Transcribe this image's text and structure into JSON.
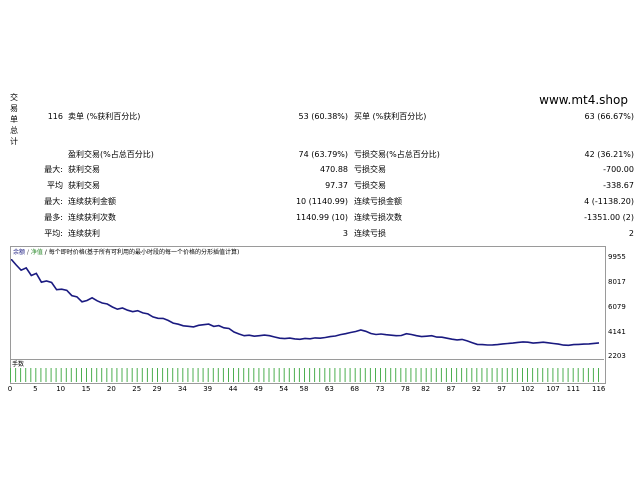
{
  "report": {
    "vertical_title": [
      "交",
      "易",
      "单",
      "总",
      "计"
    ],
    "count": "116",
    "site": "www.mt4.shop"
  },
  "stats": [
    {
      "l1": "卖单 (%获利百分比)",
      "v1": "53 (60.38%)",
      "l2": "买单 (%获利百分比)",
      "v2": "63 (66.67%)"
    },
    {
      "l1": "盈利交易(%占总百分比)",
      "v1": "74 (63.79%)",
      "l2": "亏损交易(%占总百分比)",
      "v2": "42 (36.21%)"
    },
    {
      "pre": "最大:",
      "l1": "获利交易",
      "v1": "470.88",
      "l2": "亏损交易",
      "v2": "-700.00"
    },
    {
      "pre": "平均",
      "l1": "获利交易",
      "v1": "97.37",
      "l2": "亏损交易",
      "v2": "-338.67"
    },
    {
      "pre": "最大:",
      "l1": "连续获利金额",
      "v1": "10 (1140.99)",
      "l2": "连续亏损金额",
      "v2": "4 (-1138.20)"
    },
    {
      "pre": "最多:",
      "l1": "连续获利次数",
      "v1": "1140.99 (10)",
      "l2": "连续亏损次数",
      "v2": "-1351.00 (2)"
    },
    {
      "pre": "平均:",
      "l1": "连续获利",
      "v1": "3",
      "l2": "连续亏损",
      "v2": "2"
    }
  ],
  "chart_data": {
    "type": "line",
    "title": "",
    "header": {
      "balance": "余额",
      "sep": " / ",
      "equity": "净值",
      "desc": " / 每个即时价格(基于所有可利用的最小时段的每一个价格的分形插值计算)"
    },
    "ylim": [
      2203,
      9955
    ],
    "yticks": [
      "9955",
      "8017",
      "6079",
      "4141",
      "2203"
    ],
    "xticks": [
      "0",
      "5",
      "10",
      "15",
      "20",
      "25",
      "29",
      "34",
      "39",
      "44",
      "49",
      "54",
      "58",
      "63",
      "68",
      "73",
      "78",
      "82",
      "87",
      "92",
      "97",
      "102",
      "107",
      "111",
      "116"
    ],
    "series": [
      {
        "x": [
          0,
          1,
          2,
          3,
          4,
          5,
          6,
          7,
          8,
          9,
          10,
          11,
          12,
          13,
          14,
          15,
          16,
          17,
          18,
          19,
          20,
          21,
          22,
          23,
          24,
          25,
          26,
          27,
          28,
          29,
          30,
          31,
          32,
          33,
          34,
          35,
          36,
          37,
          38,
          39,
          40,
          41,
          42,
          43,
          44,
          45,
          46,
          47,
          48,
          49,
          50,
          51,
          52,
          53,
          54,
          55,
          56,
          57,
          58,
          59,
          60,
          61,
          62,
          63,
          64,
          65,
          66,
          67,
          68,
          69,
          70,
          71,
          72,
          73,
          74,
          75,
          76,
          77,
          78,
          79,
          80,
          81,
          82,
          83,
          84,
          85,
          86,
          87,
          88,
          89,
          90,
          91,
          92,
          93,
          94,
          95,
          96,
          97,
          98,
          99,
          100,
          101,
          102,
          103,
          104,
          105,
          106,
          107,
          108,
          109,
          110,
          111,
          112,
          113,
          114,
          115,
          116
        ],
        "values": [
          9955,
          9480,
          9050,
          9240,
          8620,
          8790,
          8080,
          8180,
          8060,
          7480,
          7520,
          7430,
          7000,
          6900,
          6500,
          6600,
          6820,
          6580,
          6400,
          6320,
          6080,
          5900,
          6000,
          5820,
          5700,
          5780,
          5600,
          5520,
          5280,
          5170,
          5160,
          5000,
          4780,
          4690,
          4560,
          4520,
          4470,
          4600,
          4650,
          4700,
          4510,
          4580,
          4400,
          4340,
          4060,
          3900,
          3760,
          3800,
          3720,
          3760,
          3810,
          3760,
          3660,
          3560,
          3530,
          3570,
          3500,
          3470,
          3540,
          3510,
          3580,
          3560,
          3620,
          3690,
          3740,
          3850,
          3920,
          4020,
          4100,
          4220,
          4120,
          3940,
          3860,
          3900,
          3840,
          3800,
          3760,
          3780,
          3920,
          3860,
          3760,
          3690,
          3720,
          3760,
          3650,
          3640,
          3560,
          3480,
          3420,
          3460,
          3340,
          3200,
          3060,
          3040,
          3010,
          3020,
          3040,
          3100,
          3130,
          3160,
          3220,
          3260,
          3240,
          3160,
          3200,
          3240,
          3190,
          3130,
          3080,
          3000,
          2990,
          3040,
          3060,
          3080,
          3100,
          3140,
          3180
        ]
      }
    ]
  },
  "volume": {
    "label": "手数"
  }
}
